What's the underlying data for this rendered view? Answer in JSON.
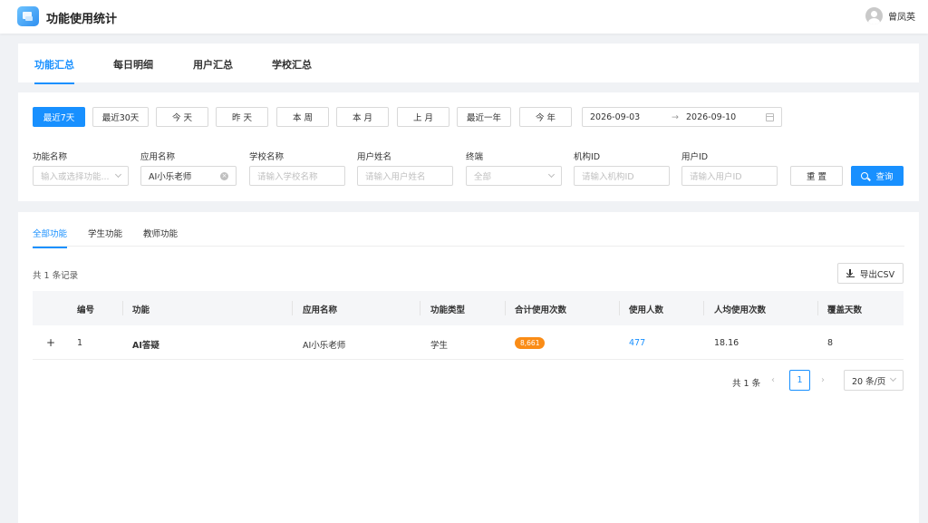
{
  "header": {
    "app_title": "功能使用统计",
    "user_name": "曾凤英",
    "brand_color": "#1890ff"
  },
  "main_tabs": [
    {
      "label": "功能汇总",
      "active": true
    },
    {
      "label": "每日明细",
      "active": false
    },
    {
      "label": "用户汇总",
      "active": false
    },
    {
      "label": "学校汇总",
      "active": false
    }
  ],
  "quick_ranges": [
    {
      "label": "最近7天",
      "active": true
    },
    {
      "label": "最近30天",
      "active": false
    },
    {
      "label": "今 天",
      "active": false
    },
    {
      "label": "昨 天",
      "active": false
    },
    {
      "label": "本 周",
      "active": false
    },
    {
      "label": "本 月",
      "active": false
    },
    {
      "label": "上 月",
      "active": false
    },
    {
      "label": "最近一年",
      "active": false
    },
    {
      "label": "今 年",
      "active": false
    }
  ],
  "date_range": {
    "start": "2026-09-03",
    "separator": "→",
    "end": "2026-09-10"
  },
  "filters": [
    {
      "label": "功能名称",
      "placeholder": "输入或选择功能...",
      "value": "",
      "type": "select"
    },
    {
      "label": "应用名称",
      "placeholder": "",
      "value": "AI小乐老师",
      "type": "select-clearable"
    },
    {
      "label": "学校名称",
      "placeholder": "请输入学校名称",
      "value": "",
      "type": "input"
    },
    {
      "label": "用户姓名",
      "placeholder": "请输入用户姓名",
      "value": "",
      "type": "input"
    },
    {
      "label": "终端",
      "placeholder": "全部",
      "value": "",
      "type": "select"
    },
    {
      "label": "机构ID",
      "placeholder": "请输入机构ID",
      "value": "",
      "type": "input"
    },
    {
      "label": "用户ID",
      "placeholder": "请输入用户ID",
      "value": "",
      "type": "input"
    }
  ],
  "actions": {
    "reset": "重 置",
    "search": "查询"
  },
  "sub_tabs": [
    {
      "label": "全部功能",
      "active": true
    },
    {
      "label": "学生功能",
      "active": false
    },
    {
      "label": "教师功能",
      "active": false
    }
  ],
  "record_count": "共 1 条记录",
  "export_label": "导出CSV",
  "table": {
    "columns": [
      "编号",
      "功能",
      "应用名称",
      "功能类型",
      "合计使用次数",
      "使用人数",
      "人均使用次数",
      "覆盖天数"
    ],
    "rows": [
      {
        "expand": "+",
        "id": "1",
        "feature": "AI答疑",
        "app": "AI小乐老师",
        "type": "学生",
        "total": "8,661",
        "users": "477",
        "avg": "18.16",
        "days": "8"
      }
    ]
  },
  "pagination": {
    "total": "共 1 条",
    "prev": "‹",
    "page": "1",
    "next": "›",
    "page_size": "20 条/页"
  }
}
